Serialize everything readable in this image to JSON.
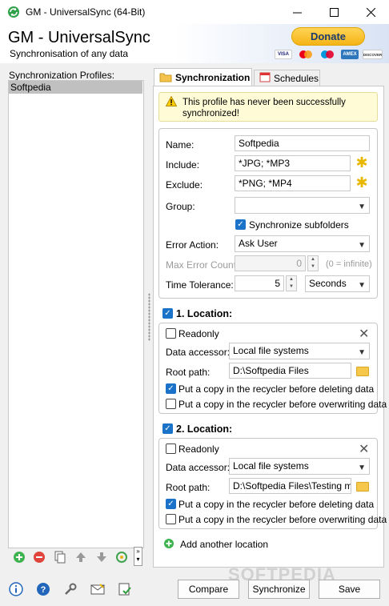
{
  "window": {
    "title": "GM - UniversalSync  (64-Bit)"
  },
  "header": {
    "app_name": "GM - UniversalSync",
    "tagline": "Synchronisation of any data",
    "donate_label": "Donate",
    "cards": [
      "VISA",
      "MC",
      "MC",
      "AMEX",
      "DISCOVER"
    ]
  },
  "profiles": {
    "label": "Synchronization Profiles:",
    "items": [
      "Softpedia"
    ]
  },
  "tabs": [
    {
      "label": "Synchronization"
    },
    {
      "label": "Schedules"
    }
  ],
  "warning": {
    "text": "This profile has never been successfully synchronized!"
  },
  "form": {
    "name_label": "Name:",
    "name_value": "Softpedia",
    "include_label": "Include:",
    "include_value": "*JPG; *MP3",
    "exclude_label": "Exclude:",
    "exclude_value": "*PNG; *MP4",
    "group_label": "Group:",
    "group_value": "",
    "sync_subfolders_label": "Synchronize subfolders",
    "error_action_label": "Error Action:",
    "error_action_value": "Ask User",
    "max_error_label": "Max Error Count:",
    "max_error_value": "0",
    "max_error_hint": "(0 = infinite)",
    "time_tol_label": "Time Tolerance:",
    "time_tol_value": "5",
    "time_unit_value": "Seconds"
  },
  "locations": [
    {
      "title": "1. Location:",
      "readonly_label": "Readonly",
      "accessor_label": "Data accessor:",
      "accessor_value": "Local file systems",
      "root_label": "Root path:",
      "root_value": "D:\\Softpedia Files",
      "recycle_delete_label": "Put a copy in the recycler before deleting data",
      "recycle_overwrite_label": "Put a copy in the recycler before overwriting data"
    },
    {
      "title": "2. Location:",
      "readonly_label": "Readonly",
      "accessor_label": "Data accessor:",
      "accessor_value": "Local file systems",
      "root_label": "Root path:",
      "root_value": "D:\\Softpedia Files\\Testing med",
      "recycle_delete_label": "Put a copy in the recycler before deleting data",
      "recycle_overwrite_label": "Put a copy in the recycler before overwriting data"
    }
  ],
  "add_location_label": "Add another location",
  "buttons": {
    "compare": "Compare",
    "synchronize": "Synchronize",
    "save": "Save"
  },
  "watermark": "SOFTPEDIA",
  "colors": {
    "accent": "#1a72c9",
    "donate": "#f5b416",
    "warning_bg": "#fffbd6"
  }
}
